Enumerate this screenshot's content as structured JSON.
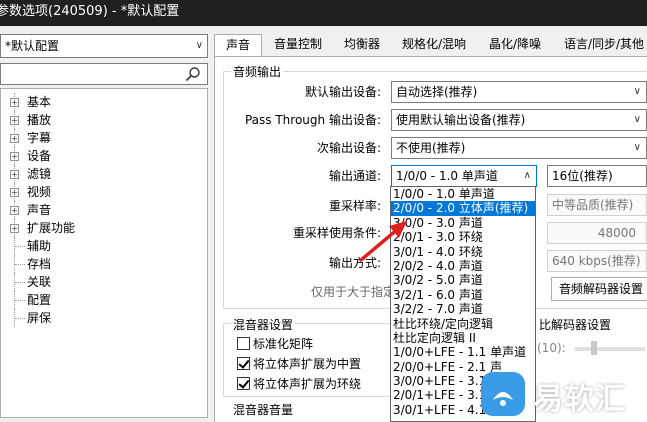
{
  "window": {
    "title": "参数选项(240509) - *默认配置"
  },
  "left": {
    "preset": "*默认配置",
    "tree": [
      {
        "label": "基本",
        "expandable": true
      },
      {
        "label": "播放",
        "expandable": true
      },
      {
        "label": "字幕",
        "expandable": true
      },
      {
        "label": "设备",
        "expandable": true
      },
      {
        "label": "滤镜",
        "expandable": true
      },
      {
        "label": "视频",
        "expandable": true
      },
      {
        "label": "声音",
        "expandable": true
      },
      {
        "label": "扩展功能",
        "expandable": true
      },
      {
        "label": "辅助",
        "expandable": false
      },
      {
        "label": "存档",
        "expandable": false
      },
      {
        "label": "关联",
        "expandable": false
      },
      {
        "label": "配置",
        "expandable": false
      },
      {
        "label": "屏保",
        "expandable": false
      }
    ]
  },
  "tabs": [
    "声音",
    "音量控制",
    "均衡器",
    "规格化/混响",
    "晶化/降噪",
    "语言/同步/其他"
  ],
  "audio_output": {
    "group_title": "音频输出",
    "default_device_label": "默认输出设备:",
    "default_device_value": "自动选择(推荐)",
    "passthrough_label": "Pass Through 输出设备:",
    "passthrough_value": "使用默认输出设备(推荐)",
    "secondary_label": "次输出设备:",
    "secondary_value": "不使用(推荐)",
    "channel_label": "输出通道:",
    "channel_value": "1/0/0 - 1.0 单声道",
    "bitdepth_value": "16位(推荐)",
    "resample_label": "重采样率:",
    "quality_value": "中等品质(推荐)",
    "resample_cond_label": "重采样使用条件:",
    "rate_value": "48000",
    "output_mode_label": "输出方式:",
    "bitrate_value": "640 kbps(推荐)",
    "only_for_label": "仅用于大于指定",
    "decoder_button": "音频解码器设置"
  },
  "mixer": {
    "group_title": "混音器设置",
    "opt1": "标准化矩阵",
    "opt2": "将立体声扩展为中置",
    "opt3": "将立体声扩展为环绕",
    "opt1_checked": false,
    "opt2_checked": true,
    "opt3_checked": true,
    "volume_title": "混音器音量"
  },
  "decoder_settings": {
    "title": "比解码器设置",
    "level": "(10):"
  },
  "channel_options": [
    "1/0/0 - 1.0 单声道",
    "2/0/0 - 2.0 立体声(推荐)",
    "3/0/0 - 3.0 声道",
    "2/0/1 - 3.0 环绕",
    "3/0/1 - 4.0 环绕",
    "2/0/2 - 4.0 声道",
    "3/0/2 - 5.0 声道",
    "3/2/1 - 6.0 声道",
    "3/2/2 - 7.0 声道",
    "杜比环绕/定向逻辑",
    "杜比定向逻辑 II",
    "1/0/0+LFE - 1.1 单声道",
    "2/0/0+LFE - 2.1 声",
    "3/0/0+LFE - 3.1",
    "2/0/1+LFE - 3.1",
    "3/0/1+LFE - 4.1"
  ],
  "watermark": {
    "text": "易软汇"
  }
}
